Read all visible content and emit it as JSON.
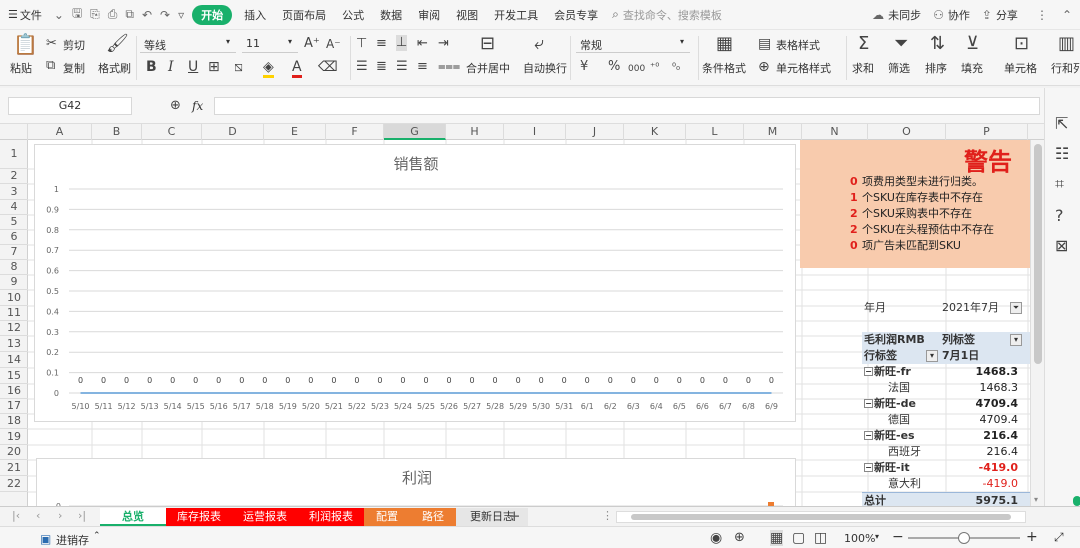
{
  "menu": {
    "file": "文件",
    "tabs": [
      "开始",
      "插入",
      "页面布局",
      "公式",
      "数据",
      "审阅",
      "视图",
      "开发工具",
      "会员专享"
    ],
    "search": "查找命令、搜索模板",
    "unsync": "未同步",
    "collab": "协作",
    "share": "分享"
  },
  "ribbon": {
    "paste": "粘贴",
    "cut": "剪切",
    "copy": "复制",
    "format_painter": "格式刷",
    "font": "等线",
    "size": "11",
    "merge": "合并居中",
    "wrap": "自动换行",
    "number_format": "常规",
    "cond_format": "条件格式",
    "table_style": "表格样式",
    "cell_style": "单元格样式",
    "sum": "求和",
    "filter": "筛选",
    "sort": "排序",
    "fill": "填充",
    "cell": "单元格",
    "row_col": "行和列",
    "bold": "B",
    "italic": "I",
    "underline": "U",
    "percent": "%",
    "thousands": "000"
  },
  "formula_bar": {
    "name_box": "G42",
    "fx": "fx",
    "value": ""
  },
  "columns": [
    "A",
    "B",
    "C",
    "D",
    "E",
    "F",
    "G",
    "H",
    "I",
    "J",
    "K",
    "L",
    "M",
    "N",
    "O",
    "P"
  ],
  "rows": [
    "1",
    "2",
    "3",
    "4",
    "5",
    "6",
    "7",
    "8",
    "9",
    "10",
    "11",
    "12",
    "13",
    "14",
    "15",
    "16",
    "17",
    "18",
    "19",
    "20",
    "21",
    "22"
  ],
  "chart_data": [
    {
      "type": "line",
      "title": "销售额",
      "categories": [
        "5/10",
        "5/11",
        "5/12",
        "5/13",
        "5/14",
        "5/15",
        "5/16",
        "5/17",
        "5/18",
        "5/19",
        "5/20",
        "5/21",
        "5/22",
        "5/23",
        "5/24",
        "5/25",
        "5/26",
        "5/27",
        "5/28",
        "5/29",
        "5/30",
        "5/31",
        "6/1",
        "6/2",
        "6/3",
        "6/4",
        "6/5",
        "6/6",
        "6/7",
        "6/8",
        "6/9"
      ],
      "values": [
        0,
        0,
        0,
        0,
        0,
        0,
        0,
        0,
        0,
        0,
        0,
        0,
        0,
        0,
        0,
        0,
        0,
        0,
        0,
        0,
        0,
        0,
        0,
        0,
        0,
        0,
        0,
        0,
        0,
        0,
        0
      ],
      "yticks": [
        "1",
        "0.9",
        "0.8",
        "0.7",
        "0.6",
        "0.5",
        "0.4",
        "0.3",
        "0.2",
        "0.1",
        "0"
      ],
      "ylim": [
        0,
        1
      ]
    },
    {
      "type": "line",
      "title": "利润",
      "yticks": [
        "0"
      ]
    }
  ],
  "warning": {
    "title": "警告",
    "items": [
      {
        "count": "0",
        "text": "项费用类型未进行归类。"
      },
      {
        "count": "1",
        "text": "个SKU在库存表中不存在"
      },
      {
        "count": "2",
        "text": "个SKU采购表中不存在"
      },
      {
        "count": "2",
        "text": "个SKU在头程预估中不存在"
      },
      {
        "count": "0",
        "text": "项广告未匹配到SKU"
      }
    ],
    "title_color": "#e0201b",
    "count_color": "#e0201b",
    "bg": "#f8cbad"
  },
  "pivot": {
    "filter_label": "年月",
    "filter_value": "2021年7月",
    "measure": "毛利润RMB",
    "col_label": "列标签",
    "row_label": "行标签",
    "col_value": "7月1日",
    "rows": [
      {
        "label": "新旺-fr",
        "value": "1468.3",
        "group": true
      },
      {
        "label": "法国",
        "value": "1468.3",
        "group": false
      },
      {
        "label": "新旺-de",
        "value": "4709.4",
        "group": true
      },
      {
        "label": "德国",
        "value": "4709.4",
        "group": false
      },
      {
        "label": "新旺-es",
        "value": "216.4",
        "group": true
      },
      {
        "label": "西班牙",
        "value": "216.4",
        "group": false
      },
      {
        "label": "新旺-it",
        "value": "-419.0",
        "group": true,
        "negative": true
      },
      {
        "label": "意大利",
        "value": "-419.0",
        "group": false,
        "negative": true
      }
    ],
    "total_label": "总计",
    "total_value": "5975.1"
  },
  "sheets": [
    {
      "name": "总览",
      "active": true,
      "bg": "#ffffff",
      "fg": "#19b06b"
    },
    {
      "name": "库存报表",
      "bg": "#ff0000",
      "fg": "#ffffff"
    },
    {
      "name": "运营报表",
      "bg": "#ff0000",
      "fg": "#ffffff"
    },
    {
      "name": "利润报表",
      "bg": "#ff0000",
      "fg": "#ffffff"
    },
    {
      "name": "配置",
      "bg": "#ed7d31",
      "fg": "#ffffff"
    },
    {
      "name": "路径",
      "bg": "#ed7d31",
      "fg": "#ffffff"
    },
    {
      "name": "更新日志",
      "bg": "#e6e6e6",
      "fg": "#333333"
    }
  ],
  "status": {
    "macro": "进销存",
    "zoom": "100%"
  }
}
